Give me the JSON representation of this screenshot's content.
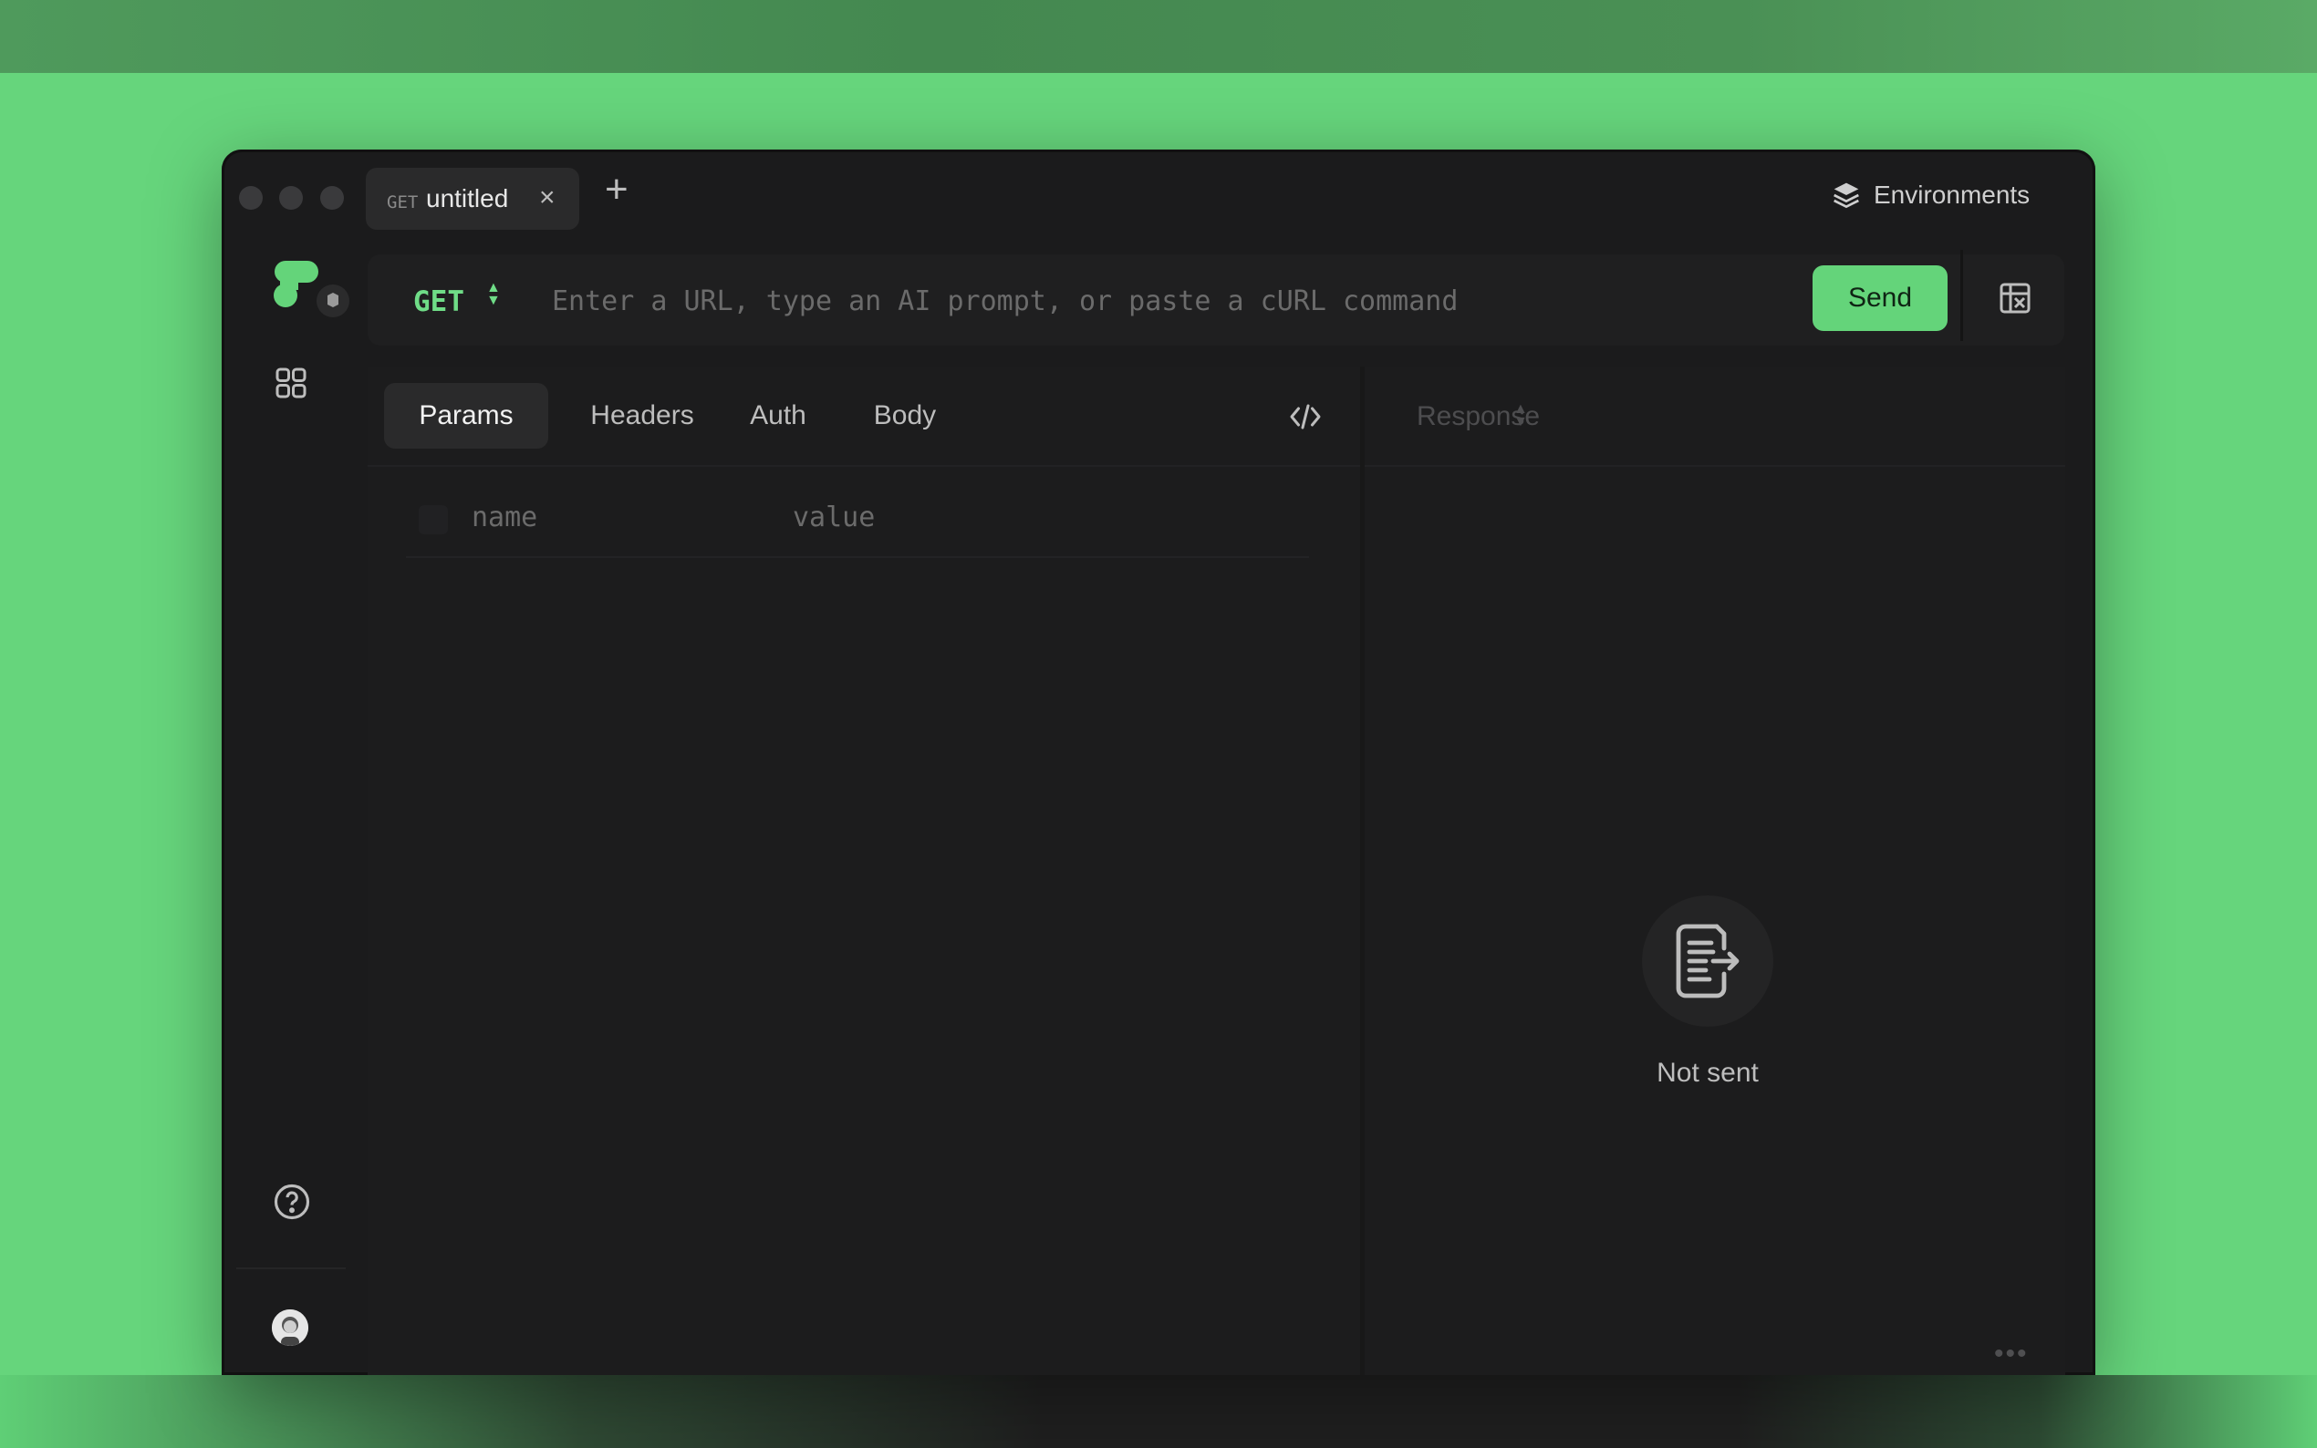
{
  "tabs": [
    {
      "method": "GET",
      "name": "untitled",
      "close": "×"
    }
  ],
  "new_tab": "+",
  "environments_label": "Environments",
  "request": {
    "method": "GET",
    "url_placeholder": "Enter a URL, type an AI prompt, or paste a cURL command",
    "url_value": "",
    "send_label": "Send"
  },
  "request_tabs": [
    {
      "label": "Params",
      "active": true
    },
    {
      "label": "Headers",
      "active": false
    },
    {
      "label": "Auth",
      "active": false
    },
    {
      "label": "Body",
      "active": false
    }
  ],
  "params": {
    "name_placeholder": "name",
    "value_placeholder": "value"
  },
  "response": {
    "label": "Response",
    "status": "Not sent",
    "more": "•••"
  },
  "icons": {
    "sidebar_logo": "app-logo-icon",
    "sidebar_grid": "grid-icon",
    "sidebar_help": "help-icon",
    "env": "layers-icon",
    "snapshot": "snapshot-icon",
    "code": "code-icon",
    "empty_state": "document-arrow-icon",
    "avatar": "avatar"
  },
  "colors": {
    "accent": "#64d47a",
    "background": "#66d57c",
    "window": "#1b1b1c"
  }
}
